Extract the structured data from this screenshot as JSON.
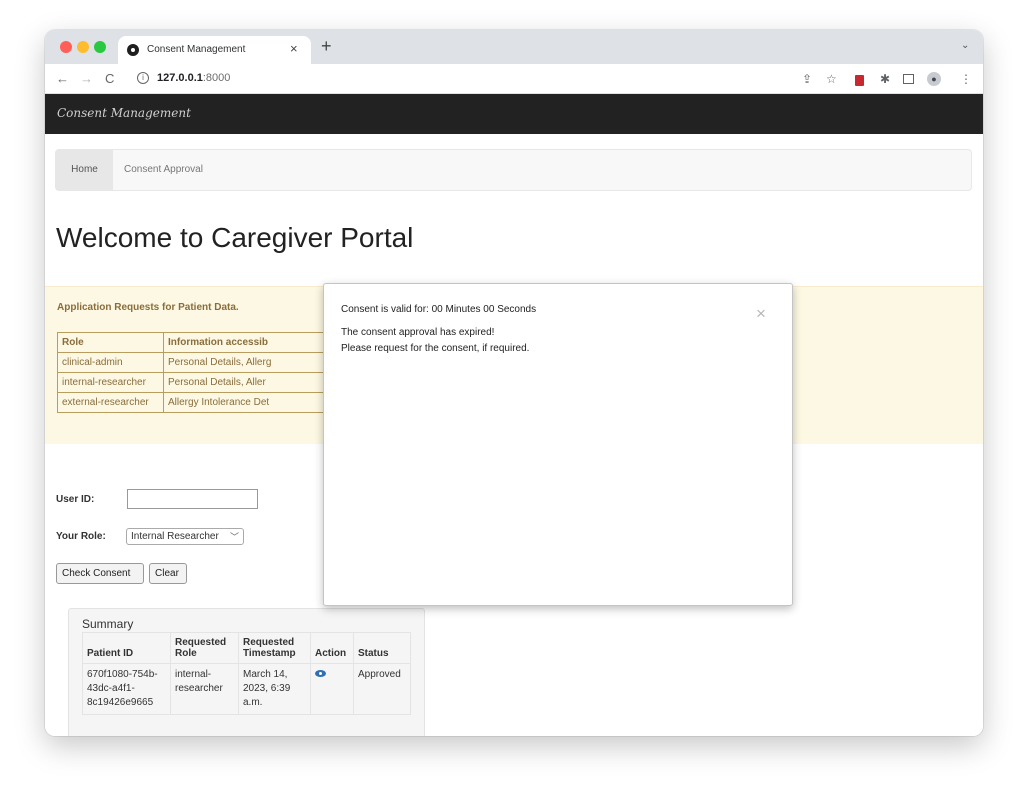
{
  "browser": {
    "tab_title": "Consent Management",
    "tab_close": "×",
    "new_tab": "+",
    "tab_menu": "⌄",
    "url_host": "127.0.0.1",
    "url_port": ":8000"
  },
  "navbar": {
    "brand": "Consent Management"
  },
  "menu": {
    "items": [
      {
        "label": "Home"
      },
      {
        "label": "Consent Approval"
      }
    ]
  },
  "page": {
    "title": "Welcome to Caregiver Portal",
    "requests_heading": "Application Requests for Patient Data.",
    "requests_table": {
      "headers": [
        "Role",
        "Information accessib"
      ],
      "rows": [
        [
          "clinical-admin",
          "Personal Details, Allerg"
        ],
        [
          "internal-researcher",
          "Personal Details, Aller"
        ],
        [
          "external-researcher",
          "Allergy Intolerance Det"
        ]
      ]
    }
  },
  "form": {
    "user_id_label": "User ID:",
    "user_id_value": "",
    "role_label": "Your Role:",
    "role_selected": "Internal Researcher",
    "check_button": "Check Consent",
    "clear_button": "Clear"
  },
  "summary": {
    "title": "Summary",
    "headers": [
      "Patient ID",
      "Requested Role",
      "Requested Timestamp",
      "Action",
      "Status"
    ],
    "rows": [
      {
        "patient_id": "670f1080-754b-43dc-a4f1-8c19426e9665",
        "role": "internal-researcher",
        "timestamp": "March 14, 2023, 6:39 a.m.",
        "action_icon": "eye-icon",
        "status": "Approved"
      }
    ]
  },
  "modal": {
    "validity": "Consent is valid for: 00 Minutes 00 Seconds",
    "close": "×",
    "message_line1": "The consent approval has expired!",
    "message_line2": "Please request for the consent, if required."
  },
  "colors": {
    "navbar_bg": "#222222",
    "alert_bg": "#fcf8e3",
    "alert_text": "#8a6d3b",
    "eye_icon": "#2e6fb7"
  }
}
